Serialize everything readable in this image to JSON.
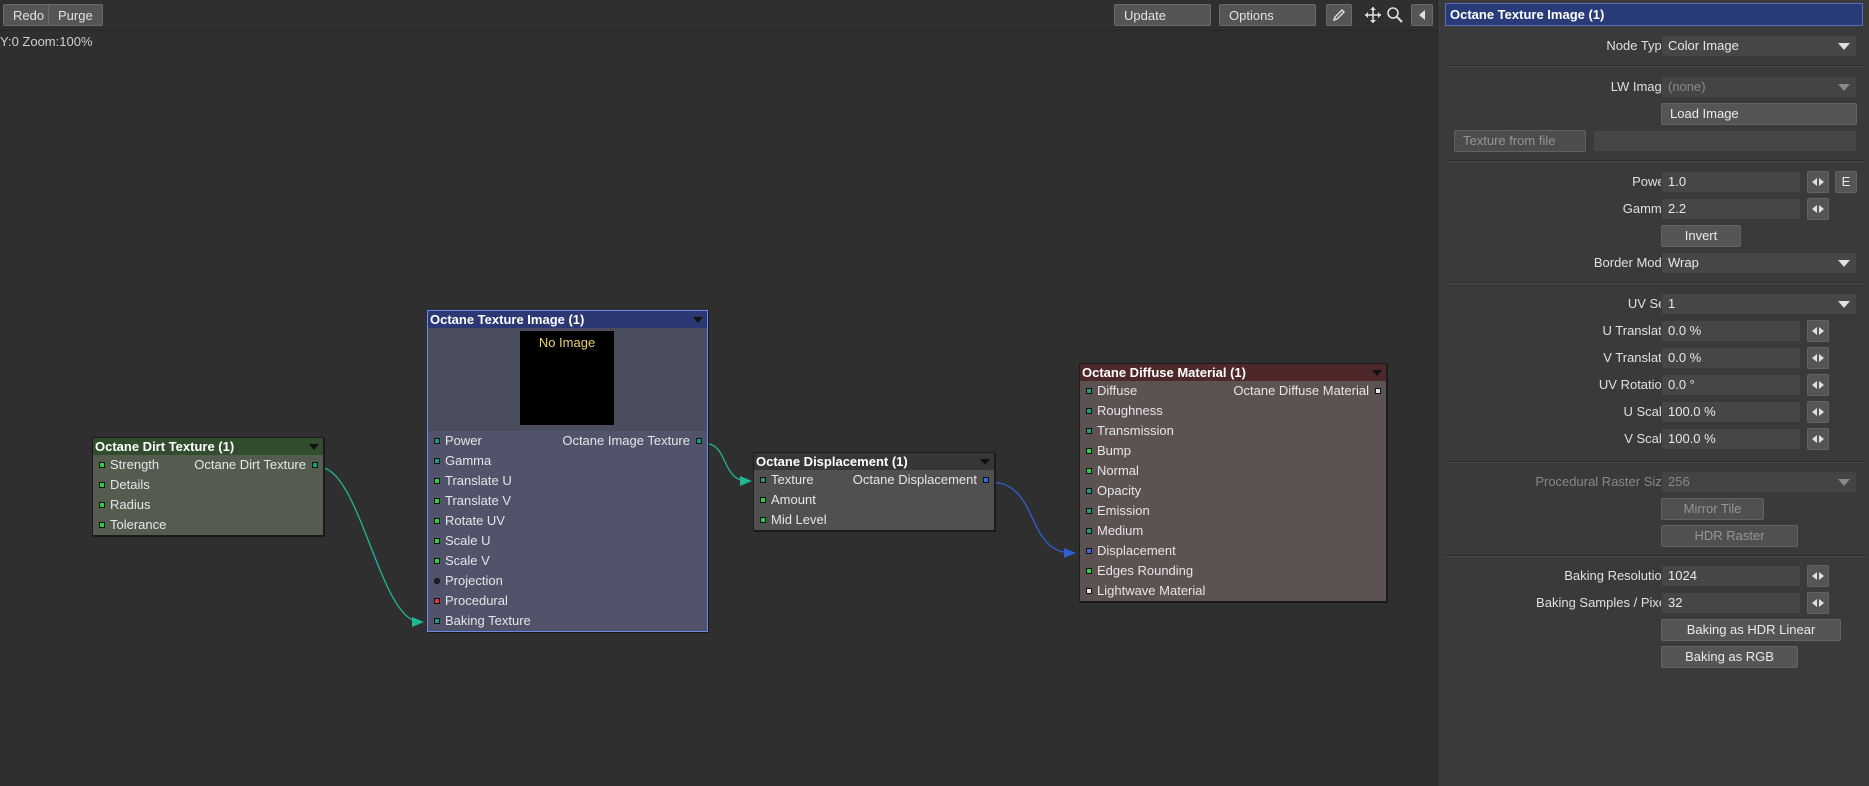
{
  "toolbar": {
    "redo_label": "Redo",
    "purge_label": "Purge",
    "update_label": "Update",
    "options_label": "Options",
    "zoom_text": "Y:0 Zoom:100%"
  },
  "nodes": {
    "dirt": {
      "title": "Octane Dirt Texture (1)",
      "output": "Octane Dirt Texture",
      "inputs": [
        "Strength",
        "Details",
        "Radius",
        "Tolerance"
      ]
    },
    "image": {
      "title": "Octane Texture Image (1)",
      "preview_text": "No Image",
      "output": "Octane Image Texture",
      "inputs": [
        "Power",
        "Gamma",
        "Translate U",
        "Translate V",
        "Rotate UV",
        "Scale U",
        "Scale V",
        "Projection",
        "Procedural",
        "Baking Texture"
      ]
    },
    "displacement": {
      "title": "Octane Displacement (1)",
      "output": "Octane Displacement",
      "inputs": [
        "Texture",
        "Amount",
        "Mid Level"
      ]
    },
    "diffuse": {
      "title": "Octane Diffuse Material (1)",
      "output": "Octane Diffuse Material",
      "inputs": [
        "Diffuse",
        "Roughness",
        "Transmission",
        "Bump",
        "Normal",
        "Opacity",
        "Emission",
        "Medium",
        "Displacement",
        "Edges Rounding",
        "Lightwave Material"
      ]
    }
  },
  "panel": {
    "title": "Octane Texture Image (1)",
    "node_type_label": "Node Type",
    "node_type_value": "Color Image",
    "lw_image_label": "LW Image",
    "lw_image_value": "(none)",
    "load_image_label": "Load Image",
    "texture_from_file_label": "Texture from file",
    "texture_from_file_value": "",
    "power_label": "Power",
    "power_value": "1.0",
    "envelope_label": "E",
    "gamma_label": "Gamma",
    "gamma_value": "2.2",
    "invert_label": "Invert",
    "border_mode_label": "Border Mode",
    "border_mode_value": "Wrap",
    "uv_set_label": "UV Set",
    "uv_set_value": "1",
    "u_translate_label": "U Translate",
    "u_translate_value": "0.0 %",
    "v_translate_label": "V Translate",
    "v_translate_value": "0.0 %",
    "uv_rotation_label": "UV Rotation",
    "uv_rotation_value": "0.0 °",
    "u_scale_label": "U Scale",
    "u_scale_value": "100.0 %",
    "v_scale_label": "V Scale",
    "v_scale_value": "100.0 %",
    "raster_size_label": "Procedural Raster Size",
    "raster_size_value": "256",
    "mirror_tile_label": "Mirror Tile",
    "hdr_raster_label": "HDR Raster",
    "baking_resolution_label": "Baking Resolution",
    "baking_resolution_value": "1024",
    "baking_samples_label": "Baking Samples / Pixel",
    "baking_samples_value": "32",
    "baking_hdr_label": "Baking as HDR Linear",
    "baking_rgb_label": "Baking as RGB"
  },
  "colors": {
    "wire_teal": "#1fb892",
    "wire_blue": "#2f5fd0",
    "port_green": "#2ecc40",
    "port_teal": "#1a9a80",
    "port_red": "#e03a3a",
    "port_blue": "#3a6ae0",
    "port_dark": "#222222",
    "port_white": "#e8e8e8"
  },
  "icons": [
    "pen-icon",
    "move-icon",
    "magnify-icon",
    "collapse-left-icon",
    "spinner-arrows-icon",
    "dropdown-arrow-icon"
  ]
}
